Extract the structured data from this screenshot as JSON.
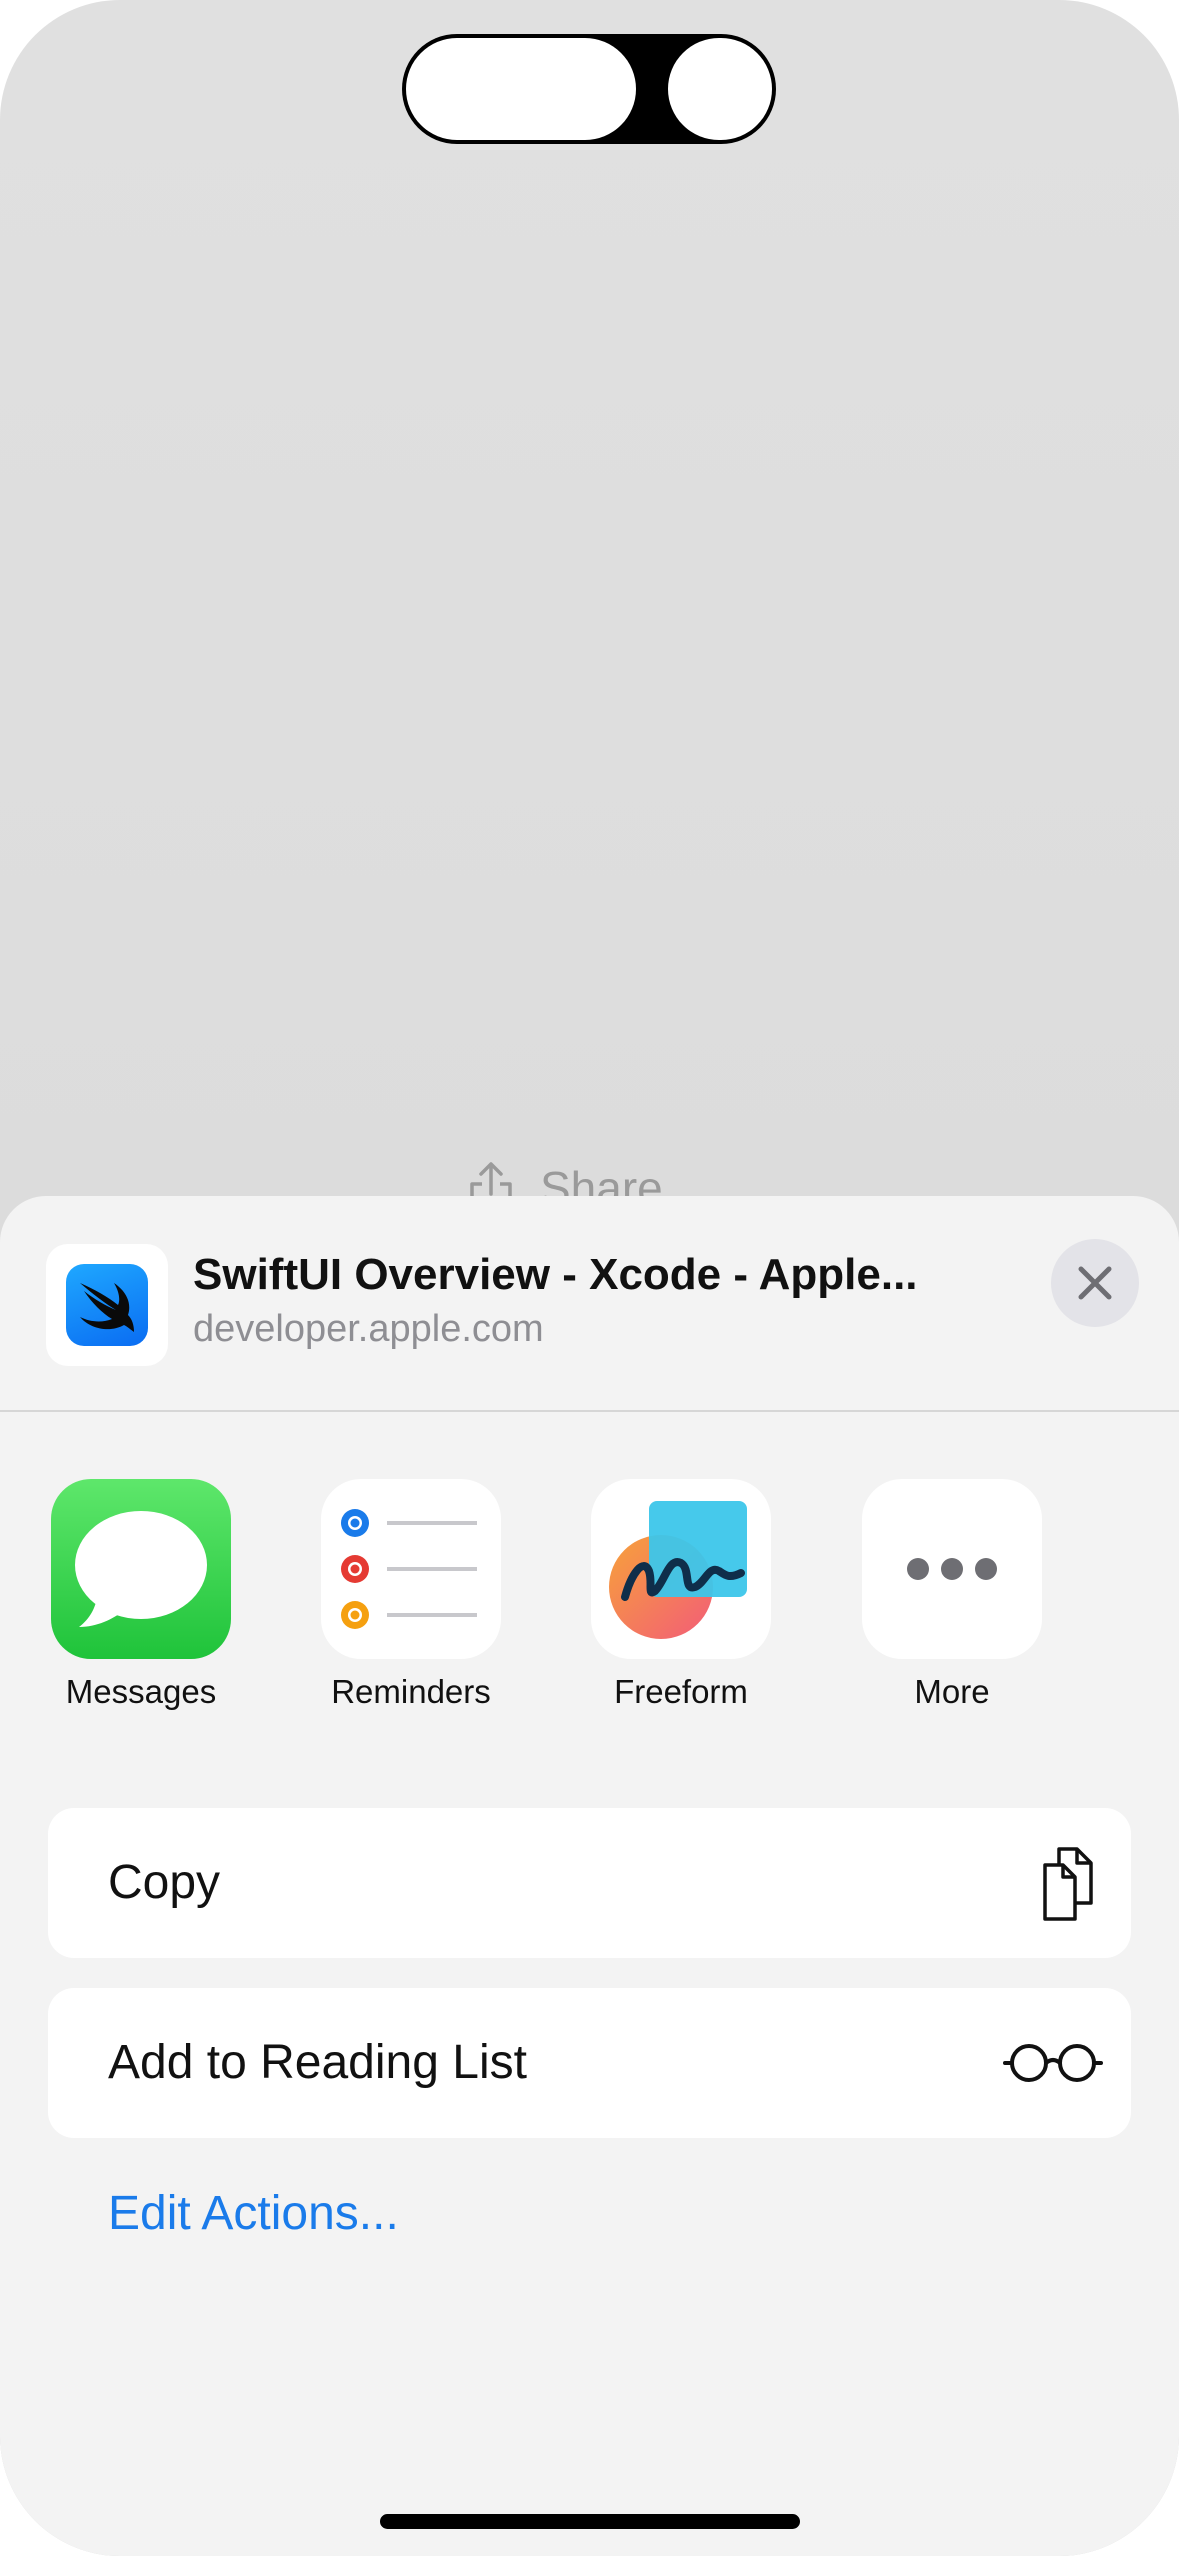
{
  "background": {
    "share_label": "Share"
  },
  "share_sheet": {
    "title": "SwiftUI Overview - Xcode - Apple...",
    "subtitle": "developer.apple.com",
    "apps": [
      {
        "label": "Messages",
        "icon": "messages-icon"
      },
      {
        "label": "Reminders",
        "icon": "reminders-icon"
      },
      {
        "label": "Freeform",
        "icon": "freeform-icon"
      },
      {
        "label": "More",
        "icon": "more-icon"
      }
    ],
    "actions": [
      {
        "label": "Copy",
        "icon": "copy-icon"
      },
      {
        "label": "Add to Reading List",
        "icon": "glasses-icon"
      }
    ],
    "edit_actions_label": "Edit Actions..."
  },
  "colors": {
    "accent": "#1a7bea",
    "messages_green": "#1fc33a",
    "sheet_background": "#f3f3f3"
  }
}
